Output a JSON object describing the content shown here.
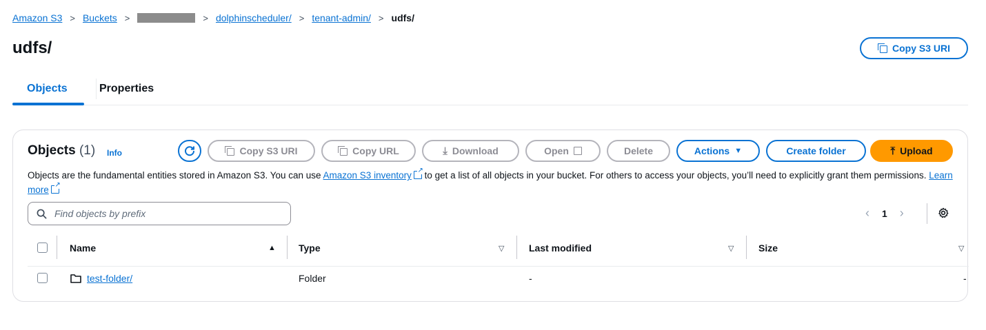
{
  "breadcrumb": {
    "items": [
      "Amazon S3",
      "Buckets",
      "dolphinscheduler/",
      "tenant-admin/"
    ],
    "current": "udfs/"
  },
  "page": {
    "title": "udfs/",
    "copy_s3_uri_label": "Copy S3 URI"
  },
  "tabs": [
    {
      "label": "Objects",
      "active": true
    },
    {
      "label": "Properties",
      "active": false
    }
  ],
  "objects_panel": {
    "title": "Objects",
    "count": "(1)",
    "info": "Info",
    "buttons": {
      "copy_s3_uri": "Copy S3 URI",
      "copy_url": "Copy URL",
      "download": "Download",
      "open": "Open",
      "delete": "Delete",
      "actions": "Actions",
      "create_folder": "Create folder",
      "upload": "Upload"
    },
    "description": {
      "part1": "Objects are the fundamental entities stored in Amazon S3. You can use ",
      "inventory_link": "Amazon S3 inventory",
      "part2": " to get a list of all objects in your bucket. For others to access your objects, you’ll need to explicitly grant them permissions. ",
      "learn_more": "Learn more"
    },
    "search": {
      "placeholder": "Find objects by prefix",
      "value": ""
    },
    "pagination": {
      "current_page": "1"
    },
    "table": {
      "columns": [
        "Name",
        "Type",
        "Last modified",
        "Size"
      ],
      "rows": [
        {
          "name": "test-folder/",
          "type": "Folder",
          "last_modified": "-",
          "size": "-"
        }
      ]
    }
  },
  "colors": {
    "accent": "#0972d3",
    "upload": "#ff9900",
    "disabled": "#b4b4bb"
  }
}
